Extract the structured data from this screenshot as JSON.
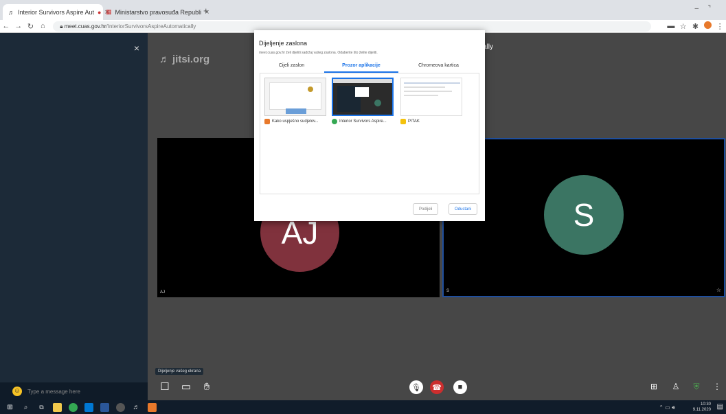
{
  "browser": {
    "tabs": [
      {
        "label": "Interior Survivors Aspire Aut",
        "active": true
      },
      {
        "label": "Ministarstvo pravosuđa Republi",
        "active": false
      }
    ],
    "new_tab": "+",
    "url_host": "meet.cuas.gov.hr",
    "url_path": "/InteriorSurvivorsAspireAutomatically"
  },
  "chat": {
    "close": "×",
    "input_placeholder": "Type a message here"
  },
  "meeting": {
    "logo": "jitsi.org",
    "top_name_fragment": "ally",
    "participants": [
      {
        "initials": "AJ",
        "label": "AJ",
        "color": "#80323d"
      },
      {
        "initials": "S",
        "label": "S",
        "color": "#3b7563"
      }
    ],
    "toolbar_tooltip": "Dijeljenje vašeg ekrana"
  },
  "share_dialog": {
    "title": "Dijeljenje zaslona",
    "subtitle": "meet.cuas.gov.hr želi dijeliti sadržaj vašeg zaslona. Odaberite što želite dijeliti.",
    "tabs": [
      {
        "label": "Cijeli zaslon",
        "active": false
      },
      {
        "label": "Prozor aplikacije",
        "active": true
      },
      {
        "label": "Chromeova kartica",
        "active": false
      }
    ],
    "windows": [
      {
        "label": "Kako uspješno sudjelov...",
        "icon_color": "#e8792b"
      },
      {
        "label": "Interior Survivors Aspire...",
        "icon_color": "#34a853"
      },
      {
        "label": "PITAK",
        "icon_color": "#f4c20d"
      }
    ],
    "share_button": "Podijeli",
    "cancel_button": "Odustani"
  },
  "taskbar": {
    "time": "10:30",
    "date": "9.11.2020"
  }
}
